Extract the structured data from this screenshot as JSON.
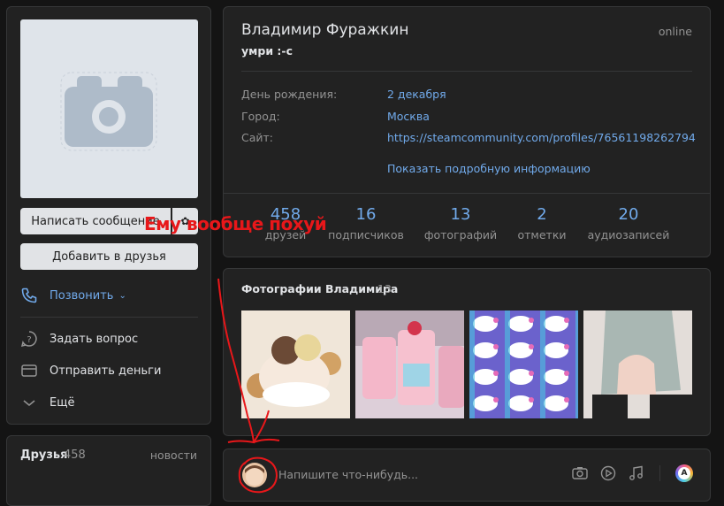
{
  "profile": {
    "name": "Владимир Фуражкин",
    "status": "умри :-с",
    "online": "online"
  },
  "info": {
    "birthday_label": "День рождения:",
    "birthday_value": "2 декабря",
    "city_label": "Город:",
    "city_value": "Москва",
    "site_label": "Сайт:",
    "site_value": "https://steamcommunity.com/profiles/765611982627947...",
    "more_link": "Показать подробную информацию"
  },
  "stats": [
    {
      "count": "458",
      "label": "друзей"
    },
    {
      "count": "16",
      "label": "подписчиков"
    },
    {
      "count": "13",
      "label": "фотографий"
    },
    {
      "count": "2",
      "label": "отметки"
    },
    {
      "count": "20",
      "label": "аудиозаписей"
    }
  ],
  "sidebar": {
    "message_button": "Написать сообщение",
    "add_friend_button": "Добавить в друзья",
    "call": "Позвонить",
    "ask_question": "Задать вопрос",
    "send_money": "Отправить деньги",
    "more": "Ещё"
  },
  "friends_block": {
    "title": "Друзья",
    "count": "458",
    "news": "новости"
  },
  "photos_block": {
    "title": "Фотографии Владимира",
    "count": "13"
  },
  "post_box": {
    "placeholder": "Напишите что-нибудь..."
  },
  "annotation": {
    "text": "Ему вообще похуй",
    "color": "#e8171a"
  },
  "colors": {
    "background": "#141414",
    "card": "#222222",
    "link": "#71aaeb",
    "muted": "#939393"
  }
}
